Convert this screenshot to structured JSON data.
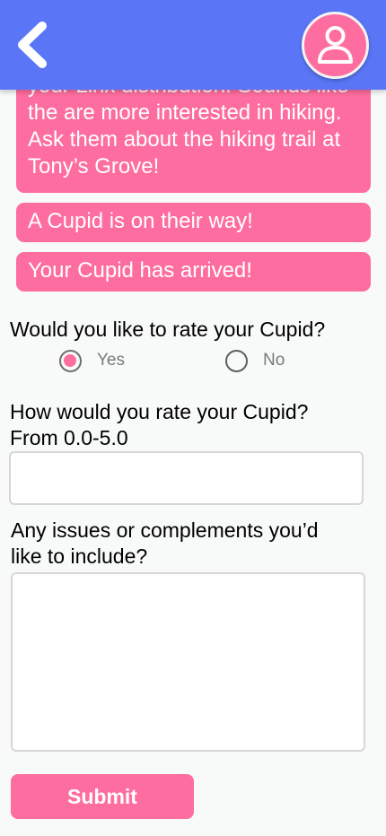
{
  "header": {
    "back_icon": "chevron-left-icon",
    "profile_icon": "user-icon",
    "accent": "#5a76f7"
  },
  "chat": {
    "bubble_color": "#fe6d9f",
    "messages": [
      "your Linx distribution. Sounds like the are more interested in hiking. Ask them about the hiking trail at Tony’s Grove!",
      "A Cupid is on their way!",
      "Your Cupid has arrived!"
    ]
  },
  "form": {
    "rate_question": "Would you like to rate your Cupid?",
    "options": [
      {
        "label": "Yes",
        "selected": true
      },
      {
        "label": "No",
        "selected": false
      }
    ],
    "rating_question_line1": "How would you rate your Cupid?",
    "rating_question_line2": "From 0.0-5.0",
    "rating_value": "",
    "issues_question_line1": "Any issues or complements you’d",
    "issues_question_line2": "like to include?",
    "issues_value": "",
    "submit_label": "Submit"
  }
}
